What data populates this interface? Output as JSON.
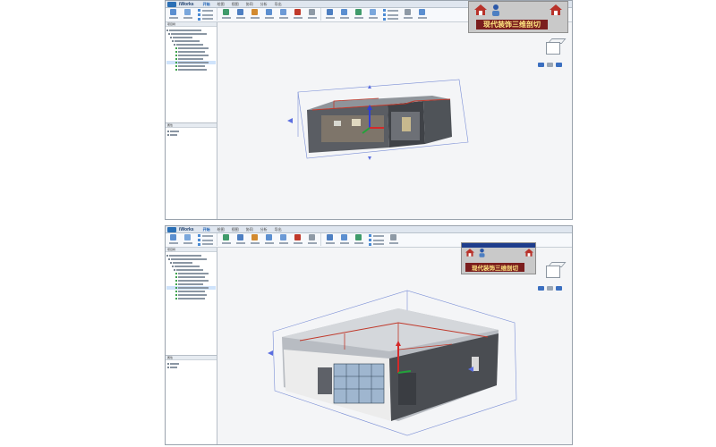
{
  "app": {
    "name": "iWorks",
    "menu_tabs": [
      "开始",
      "绘图",
      "视图",
      "协同",
      "分析",
      "导出"
    ],
    "active_tab_index": 0
  },
  "panel": {
    "title": "项目树",
    "properties_title": "属性"
  },
  "banner": {
    "title": "现代装饰三维剖切"
  },
  "colors": {
    "banner_bg": "#7b1e1e",
    "banner_text": "#ffe680",
    "axis_x": "#d42a2a",
    "axis_y": "#22a33a",
    "axis_z": "#2f3fd6",
    "pipe": "#c0392b",
    "building_wall": "#4a4d52",
    "section_box": "#7b8fd6"
  },
  "icons": [
    "home-icon",
    "person-icon",
    "viewcube-icon",
    "axis-gizmo-icon"
  ]
}
